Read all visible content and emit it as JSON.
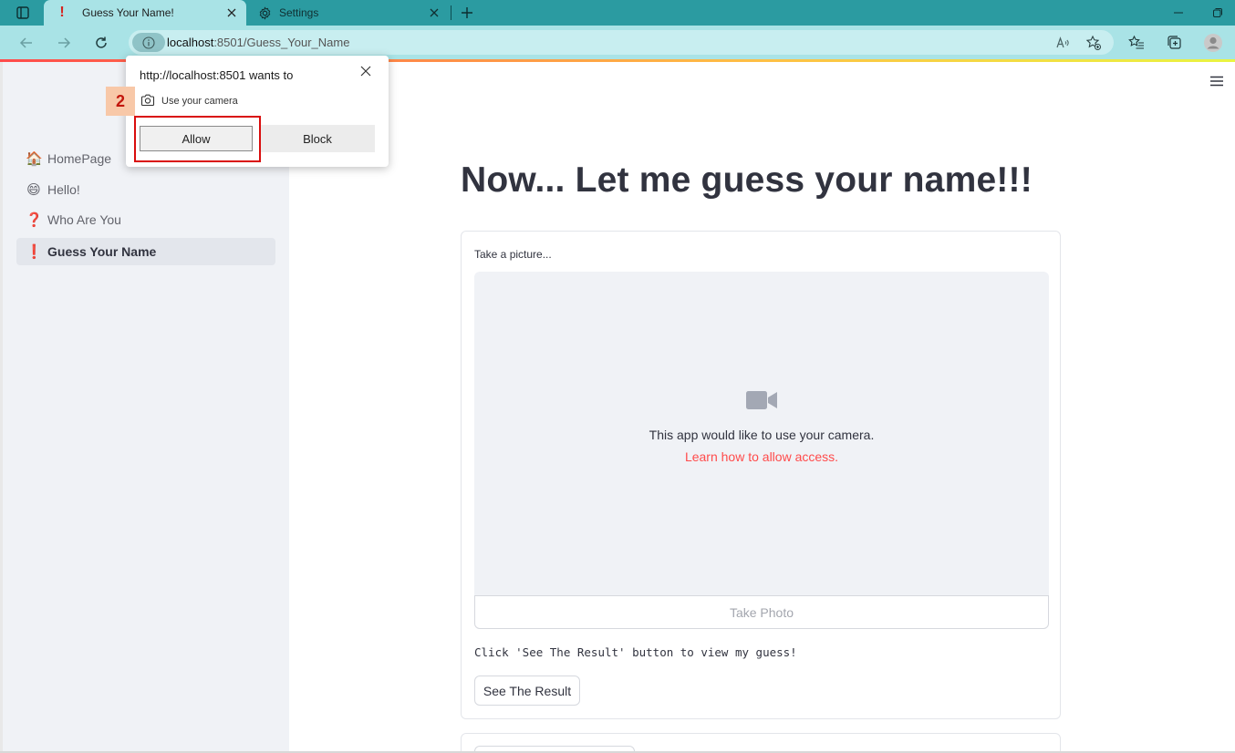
{
  "browser": {
    "tabs": [
      {
        "title": "Guess Your Name!",
        "icon": "exclamation-icon",
        "active": true
      },
      {
        "title": "Settings",
        "icon": "gear-icon",
        "active": false
      }
    ],
    "url_host": "localhost",
    "url_rest": ":8501/Guess_Your_Name",
    "accent_color": "#2b9ba1",
    "toolbar_color": "#a9e3e6"
  },
  "permission_popup": {
    "title": "http://localhost:8501 wants to",
    "request": "Use your camera",
    "allow_label": "Allow",
    "block_label": "Block"
  },
  "annotation": {
    "step_number": "2"
  },
  "sidebar": {
    "items": [
      {
        "emoji": "🏠",
        "label": "HomePage",
        "current": false
      },
      {
        "emoji": "😄",
        "label": "Hello!",
        "current": false
      },
      {
        "emoji": "❓",
        "label": "Who Are You",
        "current": false
      },
      {
        "emoji": "❗",
        "label": "Guess Your Name",
        "current": true
      }
    ]
  },
  "main": {
    "title": "Now... Let me guess your name!!!",
    "camera": {
      "label": "Take a picture...",
      "message": "This app would like to use your camera.",
      "link": "Learn how to allow access.",
      "take_photo_label": "Take Photo"
    },
    "instruction": "Click 'See The Result' button to view my guess!",
    "result_button": "See The Result"
  }
}
